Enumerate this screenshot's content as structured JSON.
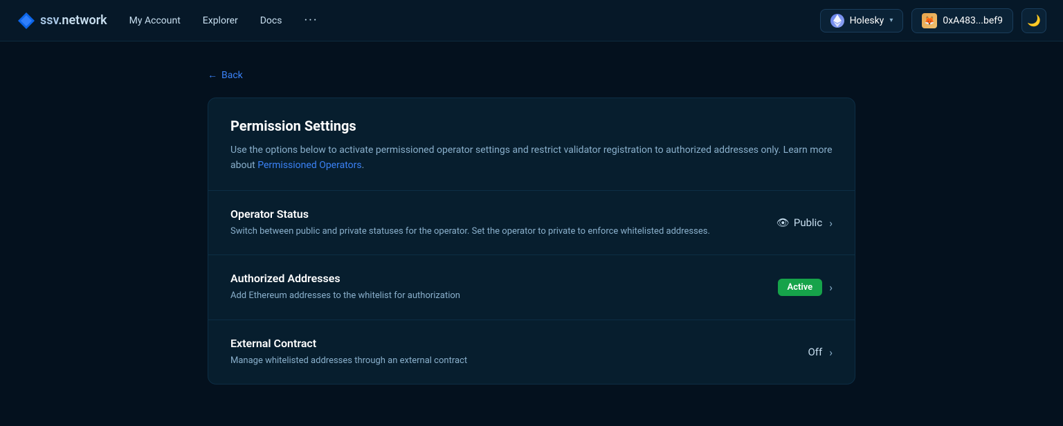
{
  "nav": {
    "logo_prefix": "ssv",
    "logo_suffix": ".network",
    "links": [
      {
        "label": "My Account"
      },
      {
        "label": "Explorer"
      },
      {
        "label": "Docs"
      }
    ],
    "more_icon": "···",
    "network": {
      "name": "Holesky",
      "chevron": "▾"
    },
    "wallet": {
      "address": "0xA483...bef9"
    },
    "theme_icon": "🌙"
  },
  "back": {
    "label": "Back",
    "arrow": "←"
  },
  "card": {
    "title": "Permission Settings",
    "description_before_link": "Use the options below to activate permissioned operator settings and restrict validator registration to authorized addresses only. Learn more about ",
    "link_text": "Permissioned Operators",
    "description_after_link": ".",
    "rows": [
      {
        "id": "operator-status",
        "title": "Operator Status",
        "description": "Switch between public and private statuses for the operator. Set the operator to private to enforce whitelisted addresses.",
        "status_type": "public",
        "status_label": "Public",
        "eye_icon": "👁"
      },
      {
        "id": "authorized-addresses",
        "title": "Authorized Addresses",
        "description": "Add Ethereum addresses to the whitelist for authorization",
        "status_type": "active",
        "status_label": "Active"
      },
      {
        "id": "external-contract",
        "title": "External Contract",
        "description": "Manage whitelisted addresses through an external contract",
        "status_type": "off",
        "status_label": "Off"
      }
    ]
  }
}
